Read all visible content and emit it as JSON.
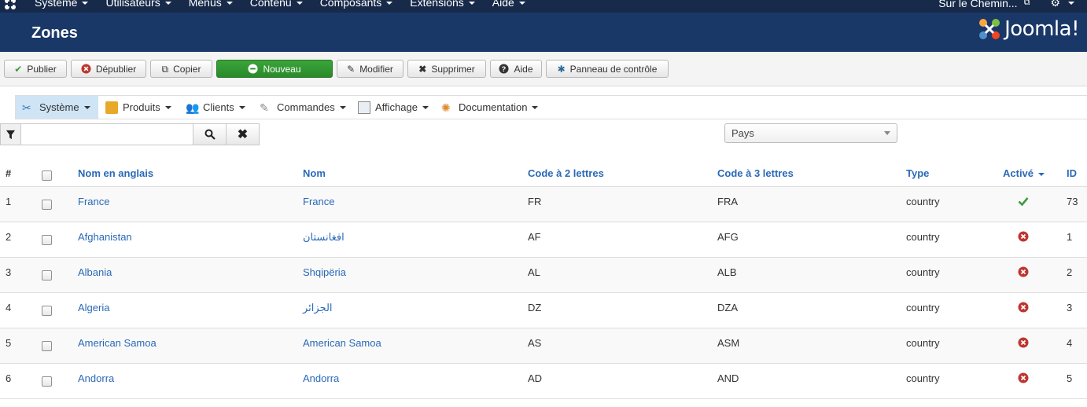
{
  "topnav": {
    "menu": [
      "Système",
      "Utilisateurs",
      "Menus",
      "Contenu",
      "Composants",
      "Extensions",
      "Aide"
    ],
    "site_link": "Sur le Chemin..."
  },
  "header": {
    "title": "Zones",
    "brand": "Joomla!"
  },
  "toolbar": {
    "publish": "Publier",
    "unpublish": "Dépublier",
    "copy": "Copier",
    "new": "Nouveau",
    "edit": "Modifier",
    "delete": "Supprimer",
    "help": "Aide",
    "control_panel": "Panneau de contrôle"
  },
  "submenu": [
    "Système",
    "Produits",
    "Clients",
    "Commandes",
    "Affichage",
    "Documentation"
  ],
  "filter": {
    "search_value": "",
    "country_select": "Pays"
  },
  "table": {
    "headers": {
      "num": "#",
      "english_name": "Nom en anglais",
      "name": "Nom",
      "code2": "Code à 2 lettres",
      "code3": "Code à 3 lettres",
      "type": "Type",
      "active": "Activé",
      "id": "ID"
    },
    "rows": [
      {
        "num": "1",
        "english_name": "France",
        "name": "France",
        "code2": "FR",
        "code3": "FRA",
        "type": "country",
        "active": true,
        "id": "73"
      },
      {
        "num": "2",
        "english_name": "Afghanistan",
        "name": "افغانستان",
        "code2": "AF",
        "code3": "AFG",
        "type": "country",
        "active": false,
        "id": "1"
      },
      {
        "num": "3",
        "english_name": "Albania",
        "name": "Shqipëria",
        "code2": "AL",
        "code3": "ALB",
        "type": "country",
        "active": false,
        "id": "2"
      },
      {
        "num": "4",
        "english_name": "Algeria",
        "name": "الجزائر",
        "code2": "DZ",
        "code3": "DZA",
        "type": "country",
        "active": false,
        "id": "3"
      },
      {
        "num": "5",
        "english_name": "American Samoa",
        "name": "American Samoa",
        "code2": "AS",
        "code3": "ASM",
        "type": "country",
        "active": false,
        "id": "4"
      },
      {
        "num": "6",
        "english_name": "Andorra",
        "name": "Andorra",
        "code2": "AD",
        "code3": "AND",
        "type": "country",
        "active": false,
        "id": "5"
      }
    ]
  },
  "colors": {
    "navbar": "#172a4a",
    "header": "#1a3867",
    "link": "#2a69b8",
    "active_green": "#3c9a3c",
    "inactive_red": "#bd362f"
  }
}
